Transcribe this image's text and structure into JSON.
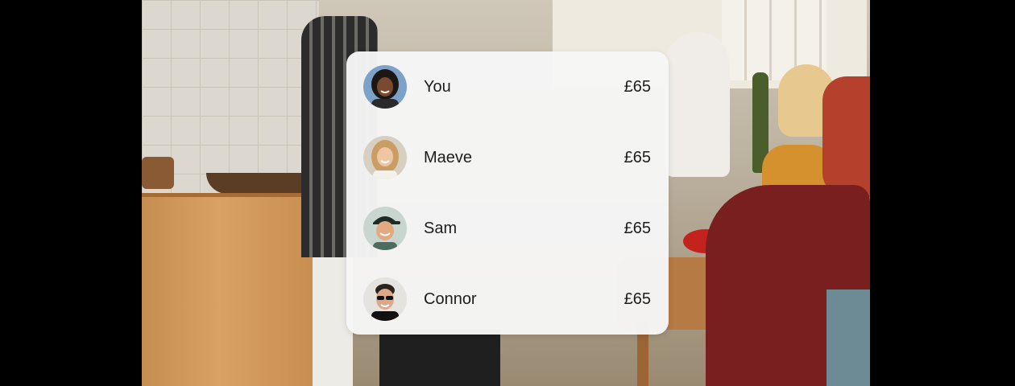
{
  "participants": [
    {
      "name": "You",
      "amount": "£65",
      "avatar_icon": "avatar-you-icon"
    },
    {
      "name": "Maeve",
      "amount": "£65",
      "avatar_icon": "avatar-maeve-icon"
    },
    {
      "name": "Sam",
      "amount": "£65",
      "avatar_icon": "avatar-sam-icon"
    },
    {
      "name": "Connor",
      "amount": "£65",
      "avatar_icon": "avatar-connor-icon"
    }
  ],
  "colors": {
    "card_background": "#f6f6f6",
    "text": "#1d1d1f",
    "page_background": "#000000"
  }
}
